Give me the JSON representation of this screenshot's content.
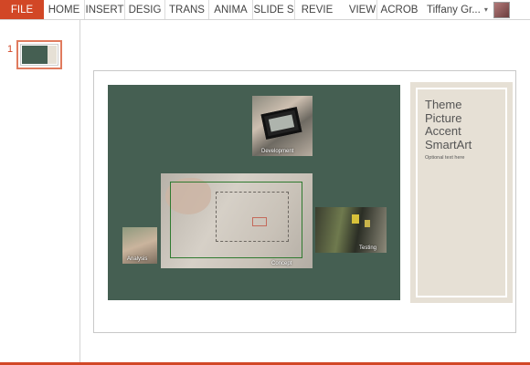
{
  "ribbon": {
    "tabs": [
      "FILE",
      "HOME",
      "INSERT",
      "DESIG",
      "TRANS",
      "ANIMA",
      "SLIDE S",
      "REVIE",
      "VIEW",
      "ACROB"
    ],
    "user_name": "Tiffany Gr...",
    "accent_color": "#d24726"
  },
  "thumbnails": {
    "slide_number": "1"
  },
  "slide": {
    "title": "Theme\nPicture\nAccent\nSmartArt",
    "subtitle": "Optional text here",
    "pictures": {
      "development": "Development",
      "concept": "Concept",
      "analysis": "Analysis",
      "testing": "Testing"
    },
    "colors": {
      "green_panel": "#455f52",
      "side_panel": "#e6e0d5"
    }
  }
}
